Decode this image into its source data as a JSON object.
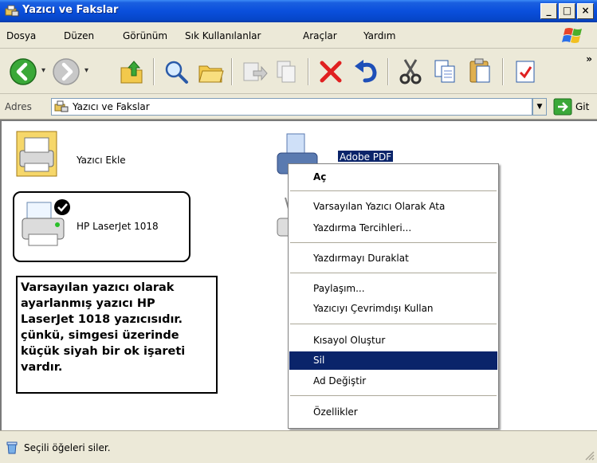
{
  "window": {
    "title": "Yazıcı ve Fakslar",
    "minimize": "_",
    "maximize": "□",
    "close": "×"
  },
  "menu": [
    "Dosya",
    "Düzen",
    "Görünüm",
    "Sık Kullanılanlar",
    "Araçlar",
    "Yardım"
  ],
  "toolbar": {
    "icons": [
      "back-icon",
      "forward-icon",
      "up-folder-icon",
      "search-icon",
      "folders-icon",
      "move-to-icon",
      "copy-to-icon",
      "delete-icon",
      "undo-icon",
      "cut-icon",
      "copy-icon",
      "paste-icon",
      "properties-icon"
    ],
    "more": "»"
  },
  "address": {
    "label": "Adres",
    "value": "Yazıcı ve Fakslar",
    "go_label": "Git"
  },
  "content": {
    "add_printer": "Yazıcı Ekle",
    "hp_printer": "HP LaserJet 1018",
    "adobe_printer": "Adobe PDF",
    "note_lines": [
      "Varsayılan yazıcı olarak",
      "ayarlanmış yazıcı HP",
      "LaserJet 1018 yazıcısıdır.",
      "çünkü, simgesi üzerinde",
      "küçük siyah bir ok işareti",
      "vardır."
    ]
  },
  "context_menu": {
    "items": [
      "Aç",
      "Varsayılan Yazıcı Olarak Ata",
      "Yazdırma Tercihleri...",
      "Yazdırmayı Duraklat",
      "Paylaşım...",
      "Yazıcıyı Çevrimdışı Kullan",
      "Kısayol Oluştur",
      "Sil",
      "Ad Değiştir",
      "Özellikler"
    ],
    "selected": "Sil"
  },
  "status": {
    "text": "Seçili öğeleri siler."
  },
  "colors": {
    "titlebar": "#0a4fdc",
    "selection": "#0a246a",
    "chrome": "#ece9d8"
  }
}
